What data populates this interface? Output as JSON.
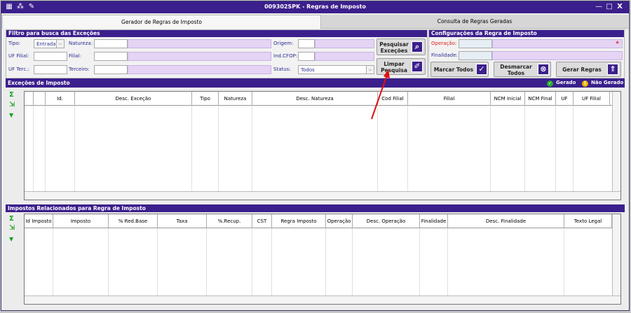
{
  "window": {
    "title": "009302SPK - Regras de Imposto",
    "controls": [
      "—",
      "□",
      "X"
    ]
  },
  "tabs": [
    "Gerador de Regras de Imposto",
    "Consulta de Regras Geradas"
  ],
  "filter": {
    "title": "Filtro para busca das Exceções",
    "tipo_label": "Tipo:",
    "tipo_value": "Entrada",
    "natureza_label": "Natureza:",
    "origem_label": "Origem:",
    "uf_filial_label": "UF Filial:",
    "filial_label": "Filial:",
    "ind_cfop_label": "Ind.CFOP:",
    "uf_terc_label": "UF Terc.:",
    "terceiro_label": "Terceiro:",
    "status_label": "Status:",
    "status_value": "Todos",
    "pesquisar_line1": "Pesquisar",
    "pesquisar_line2": "Exceções",
    "limpar_line1": "Limpar",
    "limpar_line2": "Pesquisa"
  },
  "config": {
    "title": "Configurações da Regra de Imposto",
    "operacao_label": "Operação:",
    "finalidade_label": "Finalidade:",
    "required_mark": "*",
    "marcar_todos": "Marcar Todos",
    "desmarcar_line1": "Desmarcar",
    "desmarcar_line2": "Todos",
    "gerar_regras": "Gerar Regras"
  },
  "excecoes": {
    "title": "Exceções de Imposto",
    "legend_gerado": "Gerado",
    "legend_nao_gerado": "Não Gerado",
    "columns": [
      "",
      "",
      "Id.",
      "Desc. Exceção",
      "Tipo",
      "Natureza",
      "Desc. Natureza",
      "Cod Filial",
      "Filial",
      "NCM Inicial",
      "NCM Final",
      "UF",
      "UF Filial"
    ]
  },
  "impostos": {
    "title": "Impostos Relacionados para Regra de Imposto",
    "columns": [
      "Id Imposto",
      "Imposto",
      "% Red.Base",
      "Taxa",
      "%.Recup.",
      "CST",
      "Regra Imposto",
      "Operação",
      "Desc. Operação",
      "Finalidade",
      "Desc. Finalidade",
      "Texto Legal"
    ]
  },
  "colors": {
    "header": "#3b1f8c",
    "purple_field": "#e5d4f4",
    "required": "#dd2222",
    "annotation_arrow": "#e01010"
  }
}
